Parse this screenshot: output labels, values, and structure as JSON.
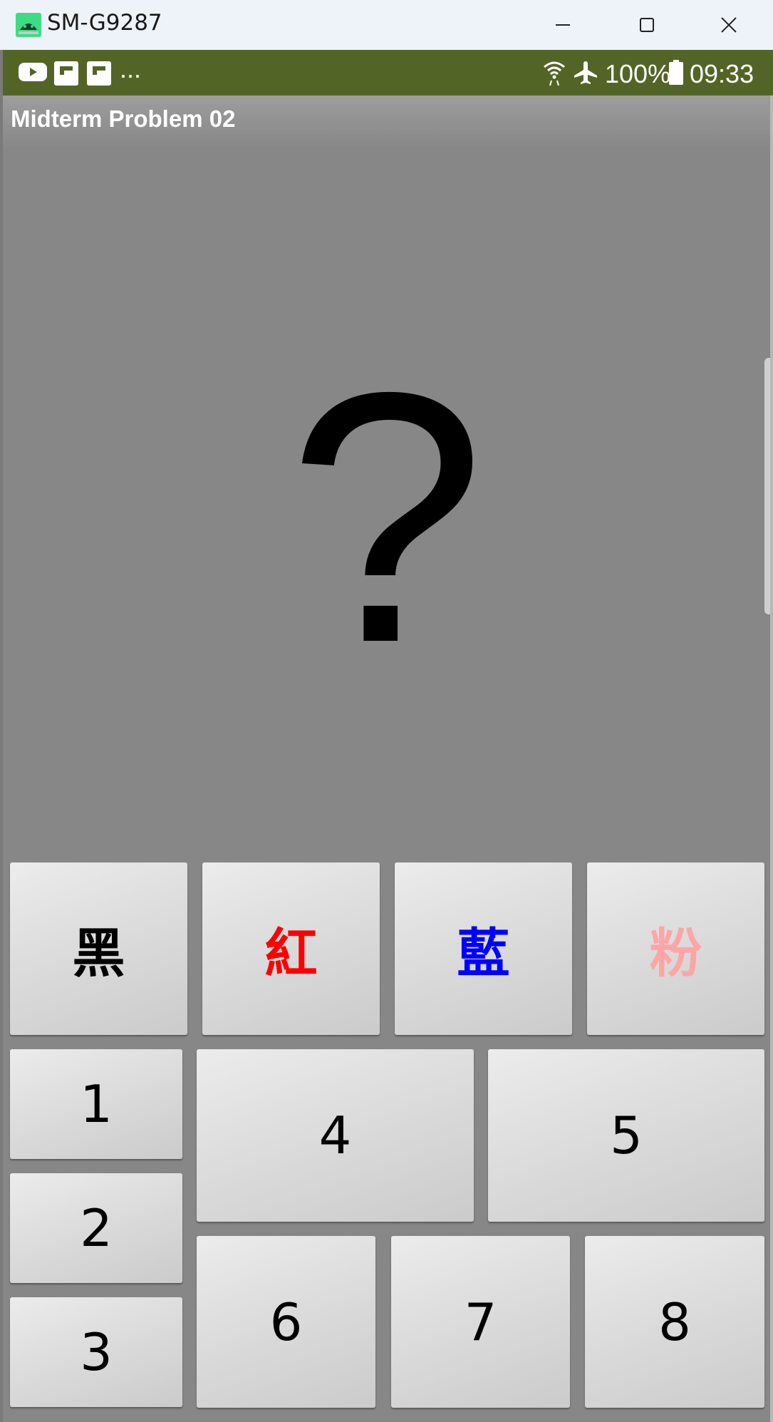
{
  "window": {
    "title": "SM-G9287"
  },
  "status_bar": {
    "more_text": "...",
    "battery_text": "100%",
    "time": "09:33",
    "icons": [
      "youtube-icon",
      "flipboard-icon",
      "flipboard-icon",
      "wifi-icon",
      "airplane-icon",
      "battery-icon"
    ]
  },
  "app_bar": {
    "title": "Midterm Problem 02"
  },
  "display": {
    "symbol": "?"
  },
  "color_buttons": [
    {
      "label": "黑",
      "color": "#000000"
    },
    {
      "label": "紅",
      "color": "#ff0000"
    },
    {
      "label": "藍",
      "color": "#0000ff"
    },
    {
      "label": "粉",
      "color": "#ffa5a5"
    }
  ],
  "number_buttons": [
    "1",
    "2",
    "3",
    "4",
    "5",
    "6",
    "7",
    "8"
  ],
  "colors": {
    "status_bar": "#536526",
    "content_bg": "#878787",
    "titlebar": "#eef3f9"
  }
}
